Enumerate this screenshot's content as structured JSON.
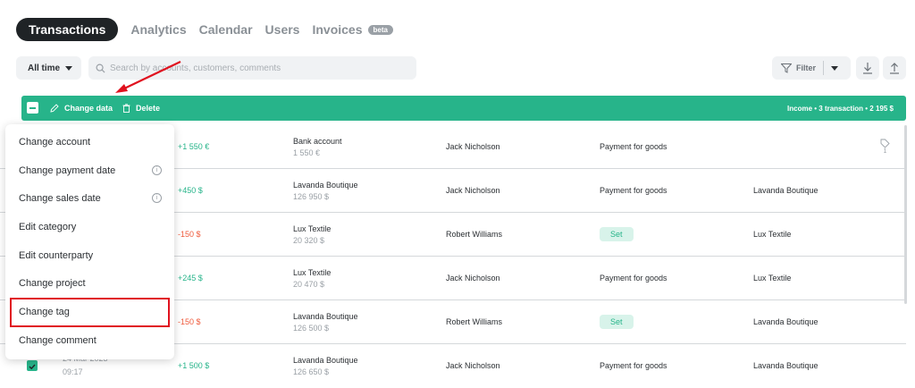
{
  "tabs": {
    "active": "Transactions",
    "others": [
      "Analytics",
      "Calendar",
      "Users",
      "Invoices"
    ],
    "beta_badge": "beta"
  },
  "toolbar": {
    "period": "All time",
    "search_placeholder": "Search by accounts, customers, comments",
    "filter_label": "Filter"
  },
  "action_bar": {
    "change_data": "Change data",
    "delete": "Delete",
    "summary": "Income • 3 transaction • 2 195 $",
    "color": "#27b48a"
  },
  "menu": {
    "items": [
      "Change account",
      "Change payment date",
      "Change sales date",
      "Edit category",
      "Edit counterparty",
      "Change project",
      "Change tag",
      "Change comment"
    ],
    "highlighted": "Change tag"
  },
  "rows": [
    {
      "amount": "+1 550 €",
      "account": "Bank account",
      "account_sub": "1 550 €",
      "counterparty": "Jack Nicholson",
      "category": "Payment for goods",
      "project": "",
      "tag_count": "1"
    },
    {
      "amount": "+450 $",
      "account": "Lavanda Boutique",
      "account_sub": "126 950 $",
      "counterparty": "Jack Nicholson",
      "category": "Payment for goods",
      "project": "Lavanda Boutique"
    },
    {
      "amount": "-150 $",
      "account": "Lux Textile",
      "account_sub": "20 320 $",
      "counterparty": "Robert Williams",
      "category": "Set",
      "project": "Lux Textile"
    },
    {
      "amount": "+245 $",
      "account": "Lux Textile",
      "account_sub": "20 470 $",
      "counterparty": "Jack Nicholson",
      "category": "Payment for goods",
      "project": "Lux Textile"
    },
    {
      "amount": "-150 $",
      "account": "Lavanda Boutique",
      "account_sub": "126 500 $",
      "counterparty": "Robert Williams",
      "category": "Set",
      "project": "Lavanda Boutique"
    },
    {
      "amount": "+1 500 $",
      "account": "Lavanda Boutique",
      "account_sub": "126 650 $",
      "counterparty": "Jack Nicholson",
      "category": "Payment for goods",
      "project": "Lavanda Boutique",
      "date": "24 Mar 2023",
      "time": "09:17"
    }
  ]
}
